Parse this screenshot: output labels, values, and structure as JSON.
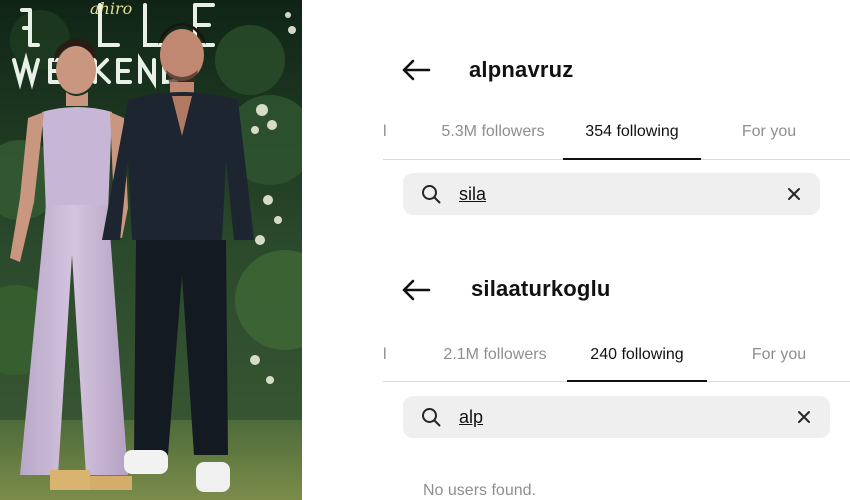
{
  "photo": {
    "description_icon": "photo-of-couple-at-event",
    "neon_text": "ELLE WEEKEND"
  },
  "panels": [
    {
      "username": "alpnavruz",
      "tabs": [
        {
          "label": "l",
          "active": false
        },
        {
          "label": "5.3M followers",
          "active": false
        },
        {
          "label": "354 following",
          "active": true
        },
        {
          "label": "For you",
          "active": false
        }
      ],
      "search": {
        "value": "sila",
        "placeholder": "Search"
      },
      "empty_text": ""
    },
    {
      "username": "silaaturkoglu",
      "tabs": [
        {
          "label": "l",
          "active": false
        },
        {
          "label": "2.1M followers",
          "active": false
        },
        {
          "label": "240 following",
          "active": true
        },
        {
          "label": "For you",
          "active": false
        }
      ],
      "search": {
        "value": "alp",
        "placeholder": "Search"
      },
      "empty_text": "No users found."
    }
  ],
  "colors": {
    "text_primary": "#111111",
    "text_secondary": "#8e8e8e",
    "search_bg": "#efefef",
    "divider": "#dbdbdb"
  }
}
